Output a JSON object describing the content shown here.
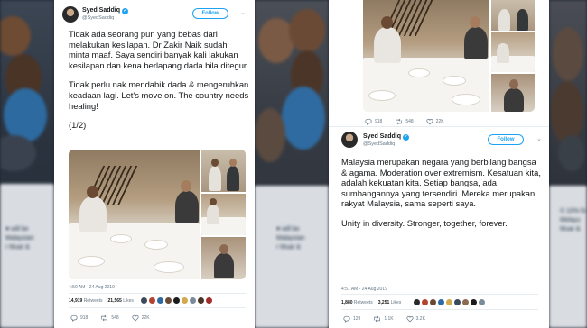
{
  "left_tweet": {
    "author_name": "Syed Saddiq",
    "handle": "@SyedSaddiq",
    "follow_label": "Follow",
    "paragraph_1": "Tidak ada seorang pun yang bebas dari melakukan kesilapan. Dr Zakir Naik sudah minta maaf. Saya sendiri banyak kali lakukan kesilapan dan kena berlapang dada bila ditegur.",
    "paragraph_2": "Tidak perlu nak mendabik dada & mengeruhkan keadaan lagi. Let's move on. The country needs healing!",
    "paragraph_3": "(1/2)",
    "timestamp": "4:50 AM - 24 Aug 2019",
    "retweets": "14,919",
    "retweets_label": "Retweets",
    "likes": "21,565",
    "likes_label": "Likes",
    "reply_count": "918",
    "retweet_count": "548",
    "like_count": "22K"
  },
  "right_tweet": {
    "author_name": "Syed Saddiq",
    "handle": "@SyedSaddiq",
    "follow_label": "Follow",
    "paragraph_1": "Malaysia merupakan negara yang berbilang bangsa & agama. Moderation over extremism. Kesatuan kita, adalah kekuatan kita. Setiap bangsa, ada sumbangannya yang tersendiri. Mereka merupakan rakyat Malaysia, sama seperti saya.",
    "paragraph_2": "Unity in diversity. Stronger, together, forever.",
    "timestamp": "4:51 AM - 24 Aug 2019",
    "retweets": "1,880",
    "retweets_label": "Retweets",
    "likes": "3,251",
    "likes_label": "Likes",
    "reply_count": "129",
    "retweet_count": "1.1K",
    "like_count": "3.2K",
    "top_reply_count": "918",
    "top_retweet_count": "548",
    "top_like_count": "22K"
  },
  "background": {
    "left_card_line_1": "♥ will be",
    "left_card_line_2": "Malaysian",
    "left_card_line_3": "r Muar &",
    "right_card_line_1": "© 10% fo",
    "right_card_line_2": "Melayu",
    "right_card_line_3": "Muar &"
  },
  "colors": {
    "accent": "#1da1f2",
    "text": "#14171a",
    "muted": "#657786"
  },
  "icons": [
    "verified-badge-icon",
    "chevron-down-icon",
    "reply-icon",
    "retweet-icon",
    "like-icon"
  ]
}
